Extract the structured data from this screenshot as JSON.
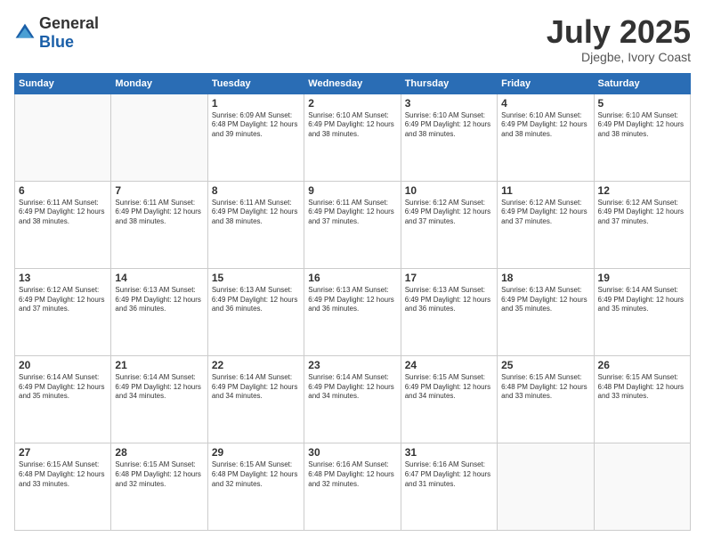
{
  "logo": {
    "text_general": "General",
    "text_blue": "Blue"
  },
  "header": {
    "month": "July 2025",
    "location": "Djegbe, Ivory Coast"
  },
  "weekdays": [
    "Sunday",
    "Monday",
    "Tuesday",
    "Wednesday",
    "Thursday",
    "Friday",
    "Saturday"
  ],
  "weeks": [
    [
      {
        "day": "",
        "info": ""
      },
      {
        "day": "",
        "info": ""
      },
      {
        "day": "1",
        "info": "Sunrise: 6:09 AM\nSunset: 6:48 PM\nDaylight: 12 hours and 39 minutes."
      },
      {
        "day": "2",
        "info": "Sunrise: 6:10 AM\nSunset: 6:49 PM\nDaylight: 12 hours and 38 minutes."
      },
      {
        "day": "3",
        "info": "Sunrise: 6:10 AM\nSunset: 6:49 PM\nDaylight: 12 hours and 38 minutes."
      },
      {
        "day": "4",
        "info": "Sunrise: 6:10 AM\nSunset: 6:49 PM\nDaylight: 12 hours and 38 minutes."
      },
      {
        "day": "5",
        "info": "Sunrise: 6:10 AM\nSunset: 6:49 PM\nDaylight: 12 hours and 38 minutes."
      }
    ],
    [
      {
        "day": "6",
        "info": "Sunrise: 6:11 AM\nSunset: 6:49 PM\nDaylight: 12 hours and 38 minutes."
      },
      {
        "day": "7",
        "info": "Sunrise: 6:11 AM\nSunset: 6:49 PM\nDaylight: 12 hours and 38 minutes."
      },
      {
        "day": "8",
        "info": "Sunrise: 6:11 AM\nSunset: 6:49 PM\nDaylight: 12 hours and 38 minutes."
      },
      {
        "day": "9",
        "info": "Sunrise: 6:11 AM\nSunset: 6:49 PM\nDaylight: 12 hours and 37 minutes."
      },
      {
        "day": "10",
        "info": "Sunrise: 6:12 AM\nSunset: 6:49 PM\nDaylight: 12 hours and 37 minutes."
      },
      {
        "day": "11",
        "info": "Sunrise: 6:12 AM\nSunset: 6:49 PM\nDaylight: 12 hours and 37 minutes."
      },
      {
        "day": "12",
        "info": "Sunrise: 6:12 AM\nSunset: 6:49 PM\nDaylight: 12 hours and 37 minutes."
      }
    ],
    [
      {
        "day": "13",
        "info": "Sunrise: 6:12 AM\nSunset: 6:49 PM\nDaylight: 12 hours and 37 minutes."
      },
      {
        "day": "14",
        "info": "Sunrise: 6:13 AM\nSunset: 6:49 PM\nDaylight: 12 hours and 36 minutes."
      },
      {
        "day": "15",
        "info": "Sunrise: 6:13 AM\nSunset: 6:49 PM\nDaylight: 12 hours and 36 minutes."
      },
      {
        "day": "16",
        "info": "Sunrise: 6:13 AM\nSunset: 6:49 PM\nDaylight: 12 hours and 36 minutes."
      },
      {
        "day": "17",
        "info": "Sunrise: 6:13 AM\nSunset: 6:49 PM\nDaylight: 12 hours and 36 minutes."
      },
      {
        "day": "18",
        "info": "Sunrise: 6:13 AM\nSunset: 6:49 PM\nDaylight: 12 hours and 35 minutes."
      },
      {
        "day": "19",
        "info": "Sunrise: 6:14 AM\nSunset: 6:49 PM\nDaylight: 12 hours and 35 minutes."
      }
    ],
    [
      {
        "day": "20",
        "info": "Sunrise: 6:14 AM\nSunset: 6:49 PM\nDaylight: 12 hours and 35 minutes."
      },
      {
        "day": "21",
        "info": "Sunrise: 6:14 AM\nSunset: 6:49 PM\nDaylight: 12 hours and 34 minutes."
      },
      {
        "day": "22",
        "info": "Sunrise: 6:14 AM\nSunset: 6:49 PM\nDaylight: 12 hours and 34 minutes."
      },
      {
        "day": "23",
        "info": "Sunrise: 6:14 AM\nSunset: 6:49 PM\nDaylight: 12 hours and 34 minutes."
      },
      {
        "day": "24",
        "info": "Sunrise: 6:15 AM\nSunset: 6:49 PM\nDaylight: 12 hours and 34 minutes."
      },
      {
        "day": "25",
        "info": "Sunrise: 6:15 AM\nSunset: 6:48 PM\nDaylight: 12 hours and 33 minutes."
      },
      {
        "day": "26",
        "info": "Sunrise: 6:15 AM\nSunset: 6:48 PM\nDaylight: 12 hours and 33 minutes."
      }
    ],
    [
      {
        "day": "27",
        "info": "Sunrise: 6:15 AM\nSunset: 6:48 PM\nDaylight: 12 hours and 33 minutes."
      },
      {
        "day": "28",
        "info": "Sunrise: 6:15 AM\nSunset: 6:48 PM\nDaylight: 12 hours and 32 minutes."
      },
      {
        "day": "29",
        "info": "Sunrise: 6:15 AM\nSunset: 6:48 PM\nDaylight: 12 hours and 32 minutes."
      },
      {
        "day": "30",
        "info": "Sunrise: 6:16 AM\nSunset: 6:48 PM\nDaylight: 12 hours and 32 minutes."
      },
      {
        "day": "31",
        "info": "Sunrise: 6:16 AM\nSunset: 6:47 PM\nDaylight: 12 hours and 31 minutes."
      },
      {
        "day": "",
        "info": ""
      },
      {
        "day": "",
        "info": ""
      }
    ]
  ]
}
